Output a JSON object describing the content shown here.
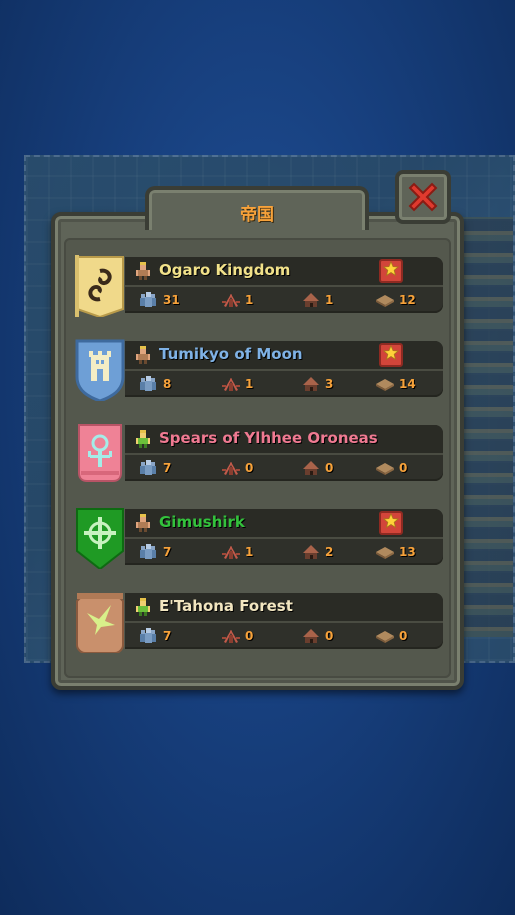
{
  "window": {
    "title": "帝国",
    "close_icon": "close-x-icon"
  },
  "colors": {
    "accent": "#f7a23a",
    "close": "#e03a2e",
    "star_badge": "#d2453a"
  },
  "kingdoms": [
    {
      "name": "Ogaro Kingdom",
      "name_color": "#f2e28a",
      "banner": {
        "shape": "flag",
        "color": "#f0d98a",
        "emblem": "swirl-icon",
        "emblem_color": "#3a2a1a"
      },
      "leader_icon": "king-icon",
      "favorite": true,
      "population": "31",
      "army": "1",
      "villages": "1",
      "zones": "12"
    },
    {
      "name": "Tumikyo of Moon",
      "name_color": "#7fb2e6",
      "banner": {
        "shape": "shield",
        "color": "#6e9fd6",
        "emblem": "tower-icon",
        "emblem_color": "#f3edc5"
      },
      "leader_icon": "king-icon",
      "favorite": true,
      "population": "8",
      "army": "1",
      "villages": "3",
      "zones": "14"
    },
    {
      "name": "Spears of Ylhhee Oroneas",
      "name_color": "#f07a92",
      "banner": {
        "shape": "tab",
        "color": "#ef8296",
        "emblem": "tree-icon",
        "emblem_color": "#a4ece8"
      },
      "leader_icon": "elf-king-icon",
      "favorite": false,
      "population": "7",
      "army": "0",
      "villages": "0",
      "zones": "0"
    },
    {
      "name": "Gimushirk",
      "name_color": "#33c23c",
      "banner": {
        "shape": "pennant",
        "color": "#1f9a24",
        "emblem": "crosshair-icon",
        "emblem_color": "#c8f2c0"
      },
      "leader_icon": "king-icon",
      "favorite": true,
      "population": "7",
      "army": "1",
      "villages": "2",
      "zones": "13"
    },
    {
      "name": "E'Tahona Forest",
      "name_color": "#f2e6c0",
      "banner": {
        "shape": "pouch",
        "color": "#c9906c",
        "emblem": "bird-icon",
        "emblem_color": "#d8f08a"
      },
      "leader_icon": "elf-king-icon",
      "favorite": false,
      "population": "7",
      "army": "0",
      "villages": "0",
      "zones": "0"
    }
  ]
}
